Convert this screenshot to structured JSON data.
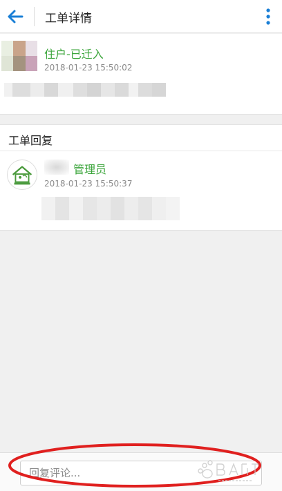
{
  "header": {
    "title": "工单详情",
    "back_icon": "arrow-left-icon",
    "menu_icon": "more-vertical-icon",
    "accent_color": "#1a7fd6"
  },
  "ticket": {
    "author": "住户-已迁入",
    "timestamp": "2018-01-23 15:50:02"
  },
  "replies": {
    "section_title": "工单回复",
    "items": [
      {
        "role": "管理员",
        "timestamp": "2018-01-23 15:50:37",
        "avatar_icon": "house-logo-icon"
      }
    ]
  },
  "comment": {
    "placeholder": "回复评论..."
  },
  "colors": {
    "name_green": "#3ba53b",
    "annotation_red": "#e0201f",
    "meta_gray": "#8a8a8a"
  }
}
